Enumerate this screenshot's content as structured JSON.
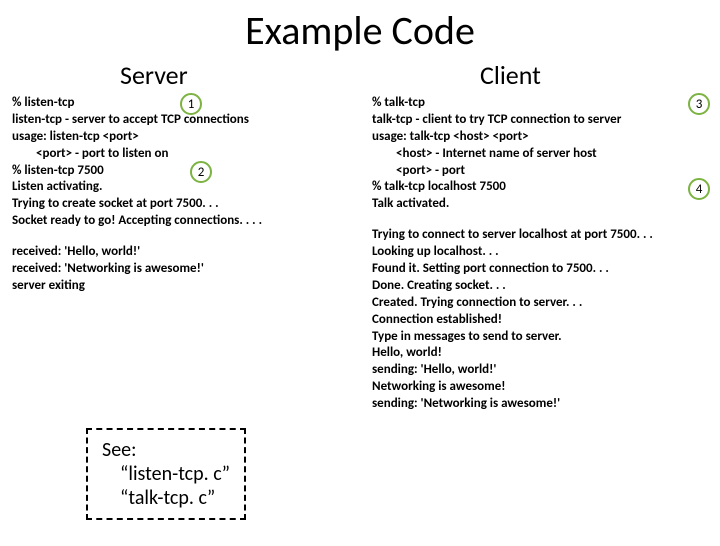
{
  "title": "Example Code",
  "server": {
    "header": "Server",
    "line1": "% listen-tcp",
    "line2": "listen-tcp - server to accept TCP connections",
    "line3": "usage: listen-tcp <port>",
    "line4": "<port>  - port to listen on",
    "line5": "% listen-tcp 7500",
    "line6": "Listen activating.",
    "line7": "Trying to create socket at port 7500. . .",
    "line8": "Socket ready to go! Accepting connections. . . .",
    "line9": "received: 'Hello, world!'",
    "line10": "received: 'Networking is awesome!'",
    "line11": "server exiting"
  },
  "client": {
    "header": "Client",
    "line1": "% talk-tcp",
    "line2": "talk-tcp - client to try TCP connection to server",
    "line3": "usage: talk-tcp <host> <port>",
    "line4": "<host> - Internet name of server host",
    "line5": "<port>  - port",
    "line6": "% talk-tcp localhost 7500",
    "line7": "Talk activated.",
    "line8": "Trying to connect to server localhost at port 7500. . .",
    "line9": "Looking up localhost. . .",
    "line10": "Found it.  Setting port connection to 7500. . .",
    "line11": "Done. Creating socket. . .",
    "line12": "Created. Trying connection to server. . .",
    "line13": "Connection established!",
    "line14": "Type in messages to send to server.",
    "line15": "Hello, world!",
    "line16": "sending: 'Hello, world!'",
    "line17": "Networking is awesome!",
    "line18": "sending: 'Networking is awesome!'"
  },
  "badges": {
    "b1": "1",
    "b2": "2",
    "b3": "3",
    "b4": "4"
  },
  "see": {
    "title": "See:",
    "item1": "“listen-tcp. c”",
    "item2": "“talk-tcp. c”"
  }
}
